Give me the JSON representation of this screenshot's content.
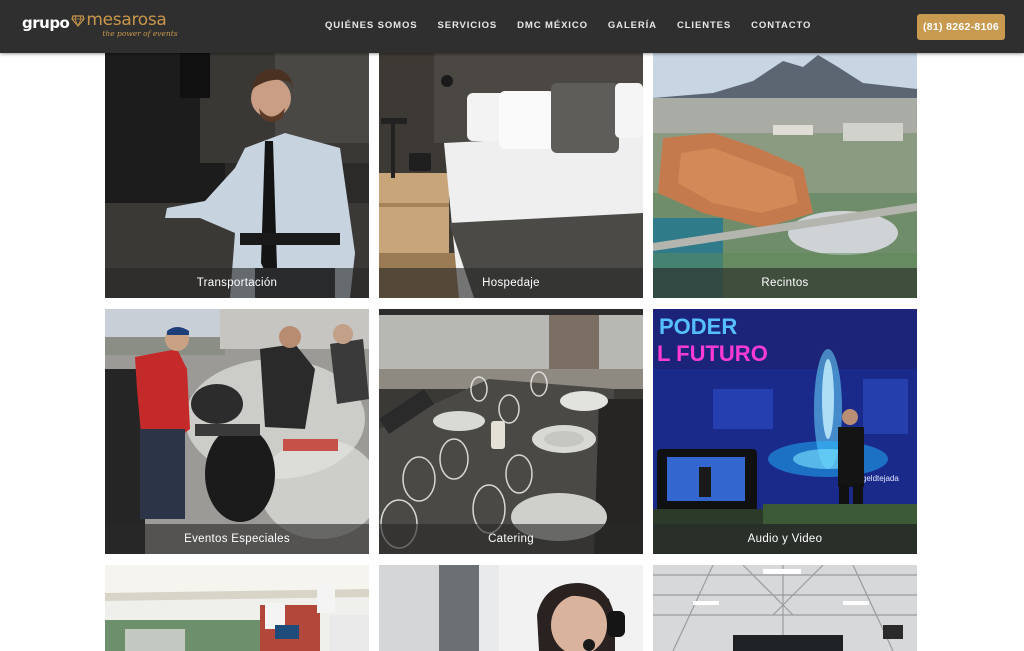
{
  "brand": {
    "word1": "grupo",
    "word2": "mesarosa",
    "tagline": "the power of events",
    "accent": "#c89a50"
  },
  "nav": {
    "items": [
      "Quiénes Somos",
      "Servicios",
      "DMC México",
      "Galería",
      "Clientes",
      "Contacto"
    ],
    "phone": "(81) 8262-8106"
  },
  "tiles": [
    {
      "label": "Transportación",
      "image": "man-in-tie-beside-bus"
    },
    {
      "label": "Hospedaje",
      "image": "hotel-bed"
    },
    {
      "label": "Recintos",
      "image": "convention-center-aerial-with-mountain"
    },
    {
      "label": "Eventos Especiales",
      "image": "outdoor-barbecue"
    },
    {
      "label": "Catering",
      "image": "glasses-on-dining-table"
    },
    {
      "label": "Audio y Video",
      "image": "speaker-on-led-stage",
      "screen_text": [
        "PODER",
        "L FUTURO"
      ],
      "handle_text": "jorgeldtejada"
    },
    {
      "image": "registration-tent"
    },
    {
      "image": "woman-with-headset"
    },
    {
      "image": "warehouse-venue"
    }
  ]
}
